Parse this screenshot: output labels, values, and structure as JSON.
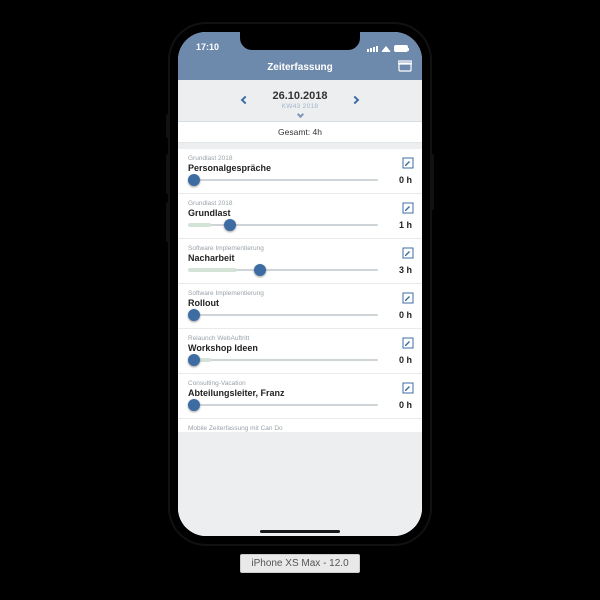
{
  "statusbar": {
    "time": "17:10"
  },
  "navbar": {
    "title": "Zeiterfassung"
  },
  "datePicker": {
    "date": "26.10.2018",
    "week": "KW43 2018"
  },
  "total": {
    "label": "Gesamt: 4h"
  },
  "items": [
    {
      "category": "Grundlast 2018",
      "title": "Personalgespräche",
      "hours": "0 h",
      "pct": 3
    },
    {
      "category": "Grundlast 2018",
      "title": "Grundlast",
      "hours": "1 h",
      "pct": 22,
      "fillPct": 12
    },
    {
      "category": "Software Implementierung",
      "title": "Nacharbeit",
      "hours": "3 h",
      "pct": 38,
      "fillPct": 26
    },
    {
      "category": "Software Implementierung",
      "title": "Rollout",
      "hours": "0 h",
      "pct": 3
    },
    {
      "category": "Relaunch WebAuftritt",
      "title": "Workshop Ideen",
      "hours": "0 h",
      "pct": 3,
      "fillPct": 12
    },
    {
      "category": "Consulting-Vacation",
      "title": "Abteilungsleiter, Franz",
      "hours": "0 h",
      "pct": 3
    }
  ],
  "partial": {
    "text": "Mobile Zeiterfassung mit Can Do"
  },
  "caption": "iPhone XS Max - 12.0"
}
